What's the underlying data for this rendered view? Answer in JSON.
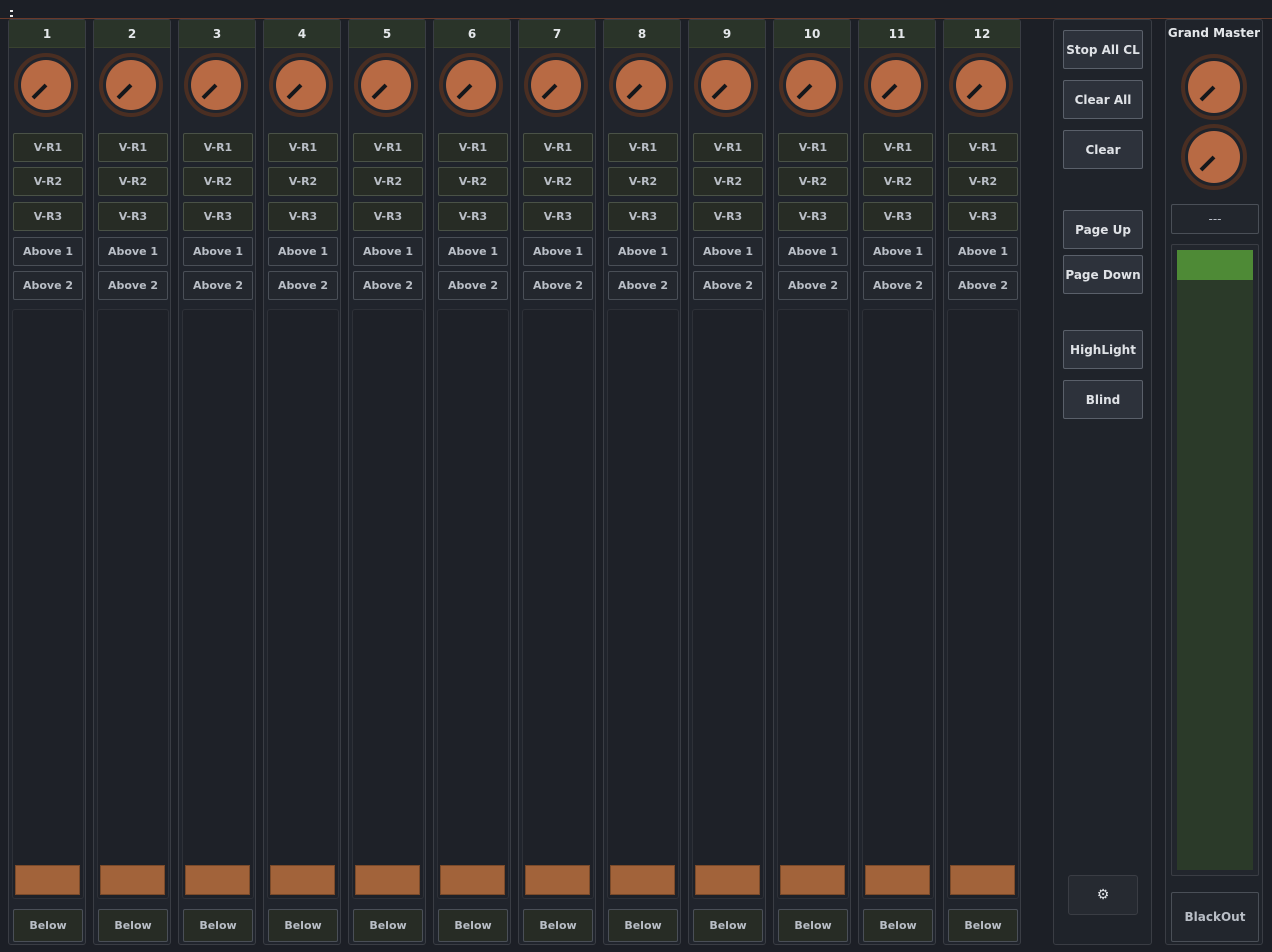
{
  "colors": {
    "knob_fill": "#b86a44",
    "knob_ring": "#4a2e22",
    "fader_handle": "#a2633a",
    "master_level": "#4e8a36",
    "header_bg": "#2a3429"
  },
  "menu": {
    "icon": "vertical-dots-icon"
  },
  "strips": [
    {
      "number": "1"
    },
    {
      "number": "2"
    },
    {
      "number": "3"
    },
    {
      "number": "4"
    },
    {
      "number": "5"
    },
    {
      "number": "6"
    },
    {
      "number": "7"
    },
    {
      "number": "8"
    },
    {
      "number": "9"
    },
    {
      "number": "10"
    },
    {
      "number": "11"
    },
    {
      "number": "12"
    }
  ],
  "strip_buttons": {
    "vr1": "V-R1",
    "vr2": "V-R2",
    "vr3": "V-R3",
    "above1": "Above 1",
    "above2": "Above 2",
    "below": "Below"
  },
  "strip_knob_level": 0,
  "strip_fader_level": 0,
  "controls": {
    "stop_all": "Stop All CL",
    "clear_all": "Clear All",
    "clear": "Clear",
    "page_up": "Page Up",
    "page_down": "Page Down",
    "highlight": "HighLight",
    "blind": "Blind",
    "settings_icon": "gear-icon"
  },
  "grand_master": {
    "title": "Grand Master",
    "value": "---",
    "level": 1.0,
    "blackout": "BlackOut"
  }
}
